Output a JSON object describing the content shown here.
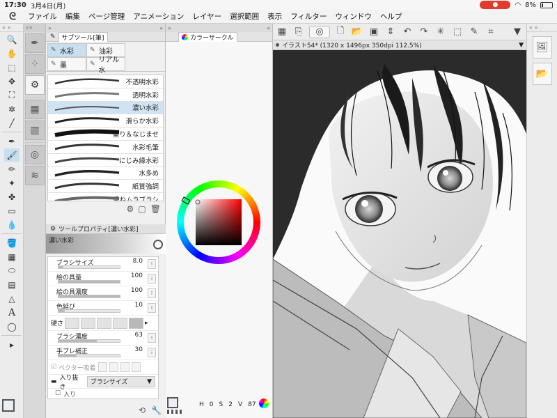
{
  "status": {
    "time": "17:30",
    "date": "3月4日(月)",
    "battery": "8%",
    "battery_level": 0.08
  },
  "menu": {
    "items": [
      "ファイル",
      "編集",
      "ページ管理",
      "アニメーション",
      "レイヤー",
      "選択範囲",
      "表示",
      "フィルター",
      "ウィンドウ",
      "ヘルプ"
    ]
  },
  "subtool": {
    "panel_title": "サブツール[筆]",
    "groups": [
      "水彩",
      "油彩",
      "墨",
      "リアル水"
    ],
    "brushes": [
      "不透明水彩",
      "透明水彩",
      "濃い水彩",
      "滑らか水彩",
      "塗り＆なじませ",
      "水彩毛筆",
      "にじみ縁水彩",
      "水多め",
      "紙質強調",
      "重ねムラブラシ"
    ]
  },
  "toolprop": {
    "panel_title": "ツールプロパティ[濃い水彩]",
    "preview_label": "濃い水彩",
    "brush_size_label": "ブラシサイズ",
    "brush_size": "8.0",
    "brush_size_level": 0.08,
    "paint_amount_label": "絵の具量",
    "paint_amount": "100",
    "paint_amount_level": 1.0,
    "paint_density_label": "絵の具濃度",
    "paint_density": "100",
    "paint_density_level": 1.0,
    "color_stretch_label": "色延び",
    "color_stretch": "10",
    "color_stretch_level": 0.1,
    "hardness_label": "硬さ",
    "brush_density_label": "ブラシ濃度",
    "brush_density": "63",
    "brush_density_level": 0.63,
    "stabilization_label": "手ブレ補正",
    "stabilization": "30",
    "stabilization_level": 0.3,
    "vector_label": "ベクター吸着",
    "fade_label": "入り抜き",
    "fade_value": "ブラシサイズ",
    "fade_sub": "入り"
  },
  "color": {
    "panel_title": "カラーサークル",
    "main_color": "#e9eff2",
    "sub_color": "#f2efe6"
  },
  "canvas": {
    "doc_title": "イラスト54* (1320 x 1496px 350dpi 112.5%)"
  },
  "footer": {
    "stat_a": "0",
    "stat_b": "2",
    "stat_c": "87"
  }
}
